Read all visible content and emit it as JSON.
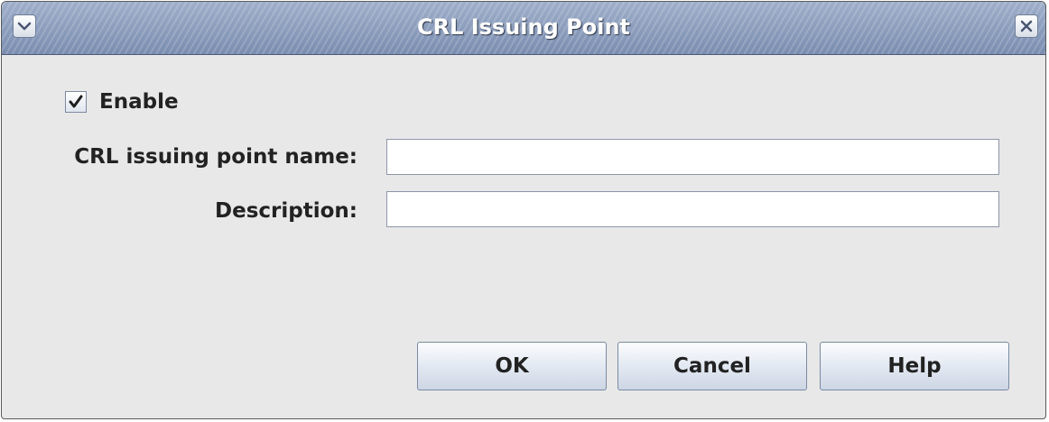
{
  "window": {
    "title": "CRL Issuing Point",
    "menu_icon": "chevron-down-icon",
    "close_icon": "close-icon"
  },
  "form": {
    "enable": {
      "label": "Enable",
      "checked": true
    },
    "name_field": {
      "label": "CRL issuing point name:",
      "value": ""
    },
    "description_field": {
      "label": "Description:",
      "value": ""
    }
  },
  "buttons": {
    "ok": "OK",
    "cancel": "Cancel",
    "help": "Help"
  },
  "colors": {
    "titlebar": "#8a9bb8",
    "dialog_background": "#e8e8e8"
  }
}
